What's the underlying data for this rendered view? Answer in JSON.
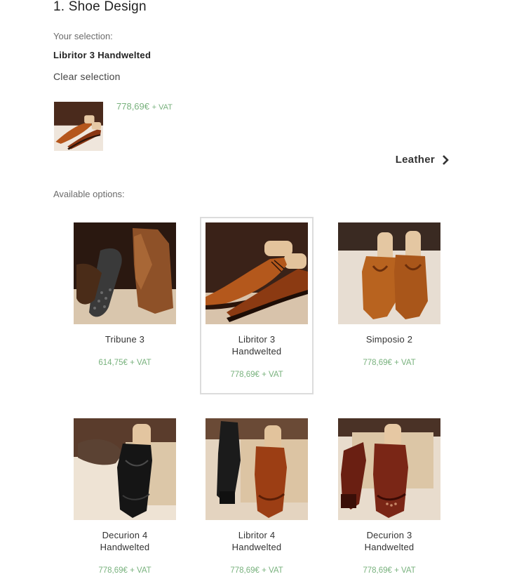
{
  "step_title": "1. Shoe Design",
  "selection": {
    "label": "Your selection:",
    "name": "Libritor 3 Handwelted",
    "clear_label": "Clear selection",
    "price": "778,69€",
    "vat": "+ VAT"
  },
  "next": {
    "label": "Leather",
    "icon": "chevron-right-icon"
  },
  "available_label": "Available options:",
  "options": [
    {
      "name_line1": "Tribune 3",
      "name_line2": "",
      "price": "614,75€",
      "vat": "+ VAT",
      "selected": false
    },
    {
      "name_line1": "Libritor 3",
      "name_line2": "Handwelted",
      "price": "778,69€",
      "vat": "+ VAT",
      "selected": true
    },
    {
      "name_line1": "Simposio 2",
      "name_line2": "",
      "price": "778,69€",
      "vat": "+ VAT",
      "selected": false
    },
    {
      "name_line1": "Decurion 4",
      "name_line2": "Handwelted",
      "price": "778,69€",
      "vat": "+ VAT",
      "selected": false
    },
    {
      "name_line1": "Libritor 4",
      "name_line2": "Handwelted",
      "price": "778,69€",
      "vat": "+ VAT",
      "selected": false
    },
    {
      "name_line1": "Decurion 3",
      "name_line2": "Handwelted",
      "price": "778,69€",
      "vat": "+ VAT",
      "selected": false
    }
  ],
  "colors": {
    "price_green": "#79b27e",
    "selected_border": "#dcdcdc",
    "text_dark": "#222222"
  }
}
